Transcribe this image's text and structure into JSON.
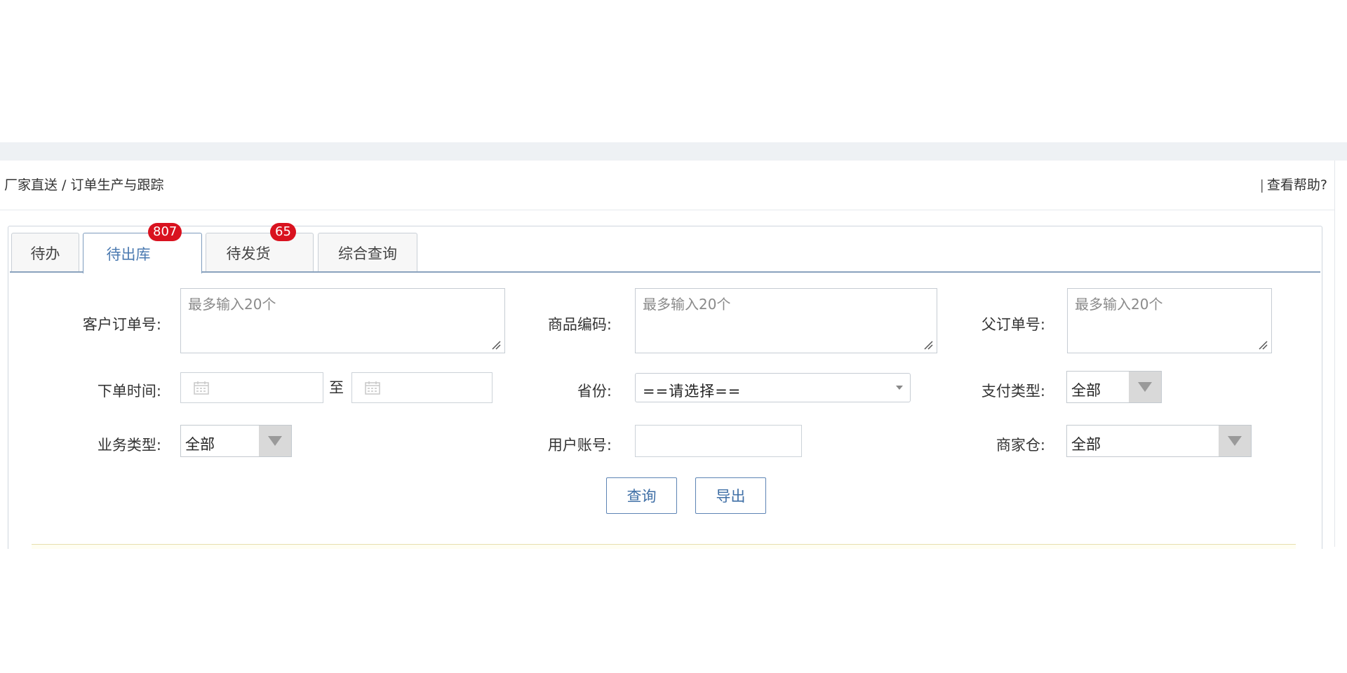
{
  "header": {
    "breadcrumb": "厂家直送 / 订单生产与跟踪",
    "help_separator": "|",
    "help_label": "查看帮助?"
  },
  "tabs": [
    {
      "label": "待办",
      "badge": null,
      "active": false
    },
    {
      "label": "待出库",
      "badge": "807",
      "active": true
    },
    {
      "label": "待发货",
      "badge": "65",
      "active": false
    },
    {
      "label": "综合查询",
      "badge": null,
      "active": false
    }
  ],
  "form": {
    "customer_order_no": {
      "label": "客户订单号:",
      "placeholder": "最多输入20个"
    },
    "product_code": {
      "label": "商品编码:",
      "placeholder": "最多输入20个"
    },
    "parent_order_no": {
      "label": "父订单号:",
      "placeholder": "最多输入20个"
    },
    "order_time": {
      "label": "下单时间:",
      "to_label": "至"
    },
    "province": {
      "label": "省份:",
      "value": "==请选择=="
    },
    "payment_type": {
      "label": "支付类型:",
      "value": "全部"
    },
    "business_type": {
      "label": "业务类型:",
      "value": "全部"
    },
    "user_account": {
      "label": "用户账号:",
      "value": ""
    },
    "merchant_warehouse": {
      "label": "商家仓:",
      "value": "全部"
    }
  },
  "actions": {
    "query_label": "查询",
    "export_label": "导出"
  },
  "colors": {
    "badge": "#d9121f",
    "active_tab_text": "#4a79b0",
    "button_text": "#3f6fa6",
    "button_border": "#5d84b4"
  }
}
